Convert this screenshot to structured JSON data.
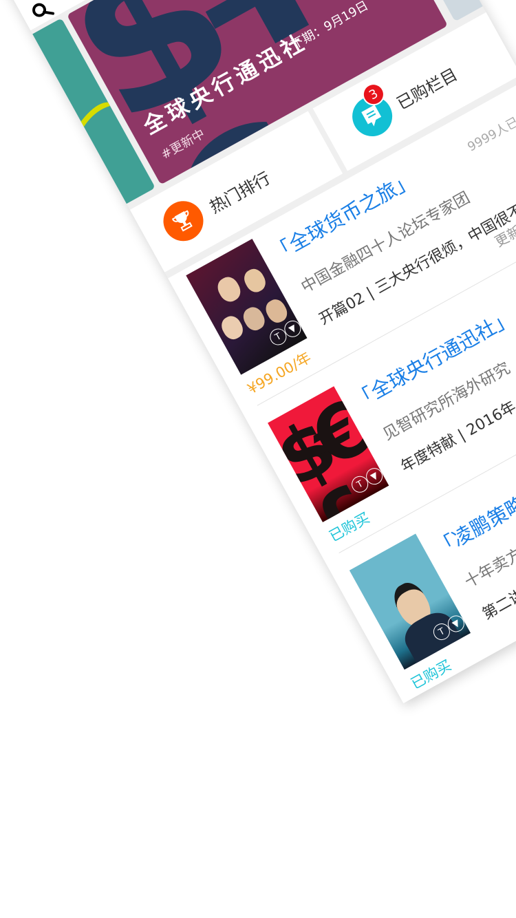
{
  "header": {
    "search_icon": "search-icon"
  },
  "banner": {
    "title": "全球央行通迅社",
    "next_issue": "下期：9月19日",
    "tag": "#更新中",
    "colors": {
      "main": "#8e3766",
      "shape": "#22385a",
      "prev": "#40a095",
      "next": "#cfd9e0"
    }
  },
  "shortcuts": [
    {
      "label": "热门排行",
      "icon": "trophy-icon",
      "color": "#ff5a00"
    },
    {
      "label": "已购栏目",
      "icon": "bookmark-message-icon",
      "color": "#12c0d4",
      "badge": "3"
    }
  ],
  "items": [
    {
      "title": "「全球货币之旅」",
      "count": "9999人已",
      "subtitle": "中国金融四十人论坛专家团",
      "line3": "开篇02 | 三大央行很烦，中国很不",
      "price": "¥99.00/年",
      "update": "更新"
    },
    {
      "title": "「全球央行通迅社」",
      "subtitle": "见智研究所海外研究",
      "line3": "年度特献 | 2016年",
      "status": "已购买"
    },
    {
      "title": "「凌鹏策略",
      "subtitle": "十年卖方",
      "line3": "第二讲",
      "status": "已购买"
    }
  ],
  "thumb_icons": {
    "text": "T",
    "play": "▼"
  }
}
